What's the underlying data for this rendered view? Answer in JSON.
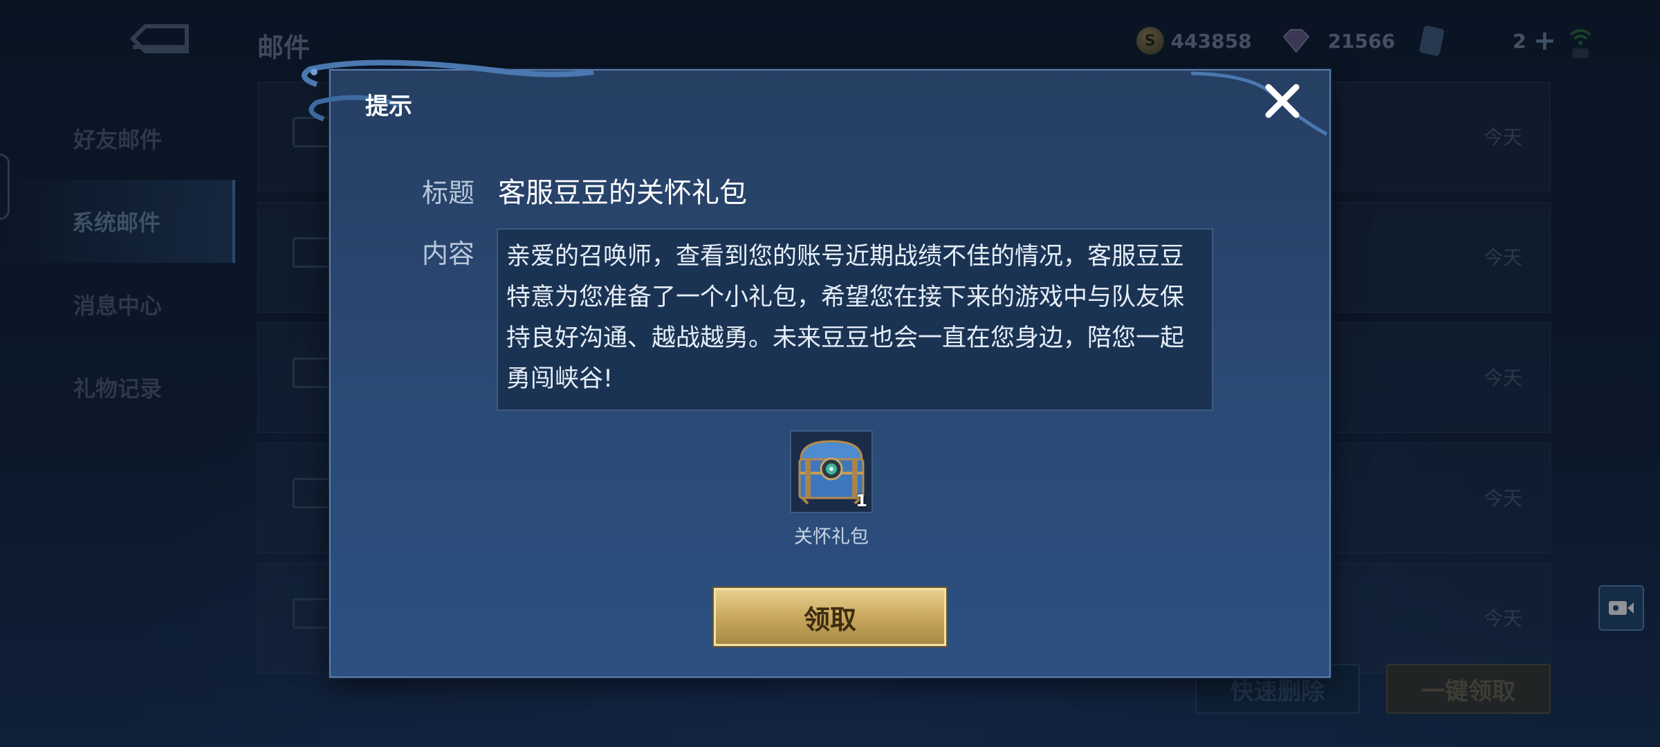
{
  "background": {
    "title": "邮件",
    "resources": {
      "gold": "443858",
      "gems": "21566",
      "cards": "2"
    },
    "sidebar": [
      {
        "label": "好友邮件",
        "active": false
      },
      {
        "label": "系统邮件",
        "active": true
      },
      {
        "label": "消息中心",
        "active": false
      },
      {
        "label": "礼物记录",
        "active": false
      }
    ],
    "mail_rows": [
      {
        "date": "今天"
      },
      {
        "date": "今天"
      },
      {
        "date": "今天"
      },
      {
        "date": "今天"
      },
      {
        "date": "今天"
      }
    ],
    "buttons": {
      "quick_delete": "快速删除",
      "claim_all": "一键领取"
    }
  },
  "dialog": {
    "title": "提示",
    "subject_label": "标题",
    "subject": "客服豆豆的关怀礼包",
    "content_label": "内容",
    "content_lines": [
      "亲爱的召唤师，查看到您的账号近期战绩不佳的情况，客服豆豆",
      "特意为您准备了一个小礼包，希望您在接下来的游戏中与队友保",
      "持良好沟通、越战越勇。未来豆豆也会一直在您身边，陪您一起",
      "勇闯峡谷!"
    ],
    "item": {
      "name": "关怀礼包",
      "count": "1",
      "icon": "treasure-chest-icon"
    },
    "claim_label": "领取"
  },
  "colors": {
    "dialog_bg": "#2b4a75",
    "claim_gold": "#caa85c",
    "content_bg": "#1b3353"
  }
}
